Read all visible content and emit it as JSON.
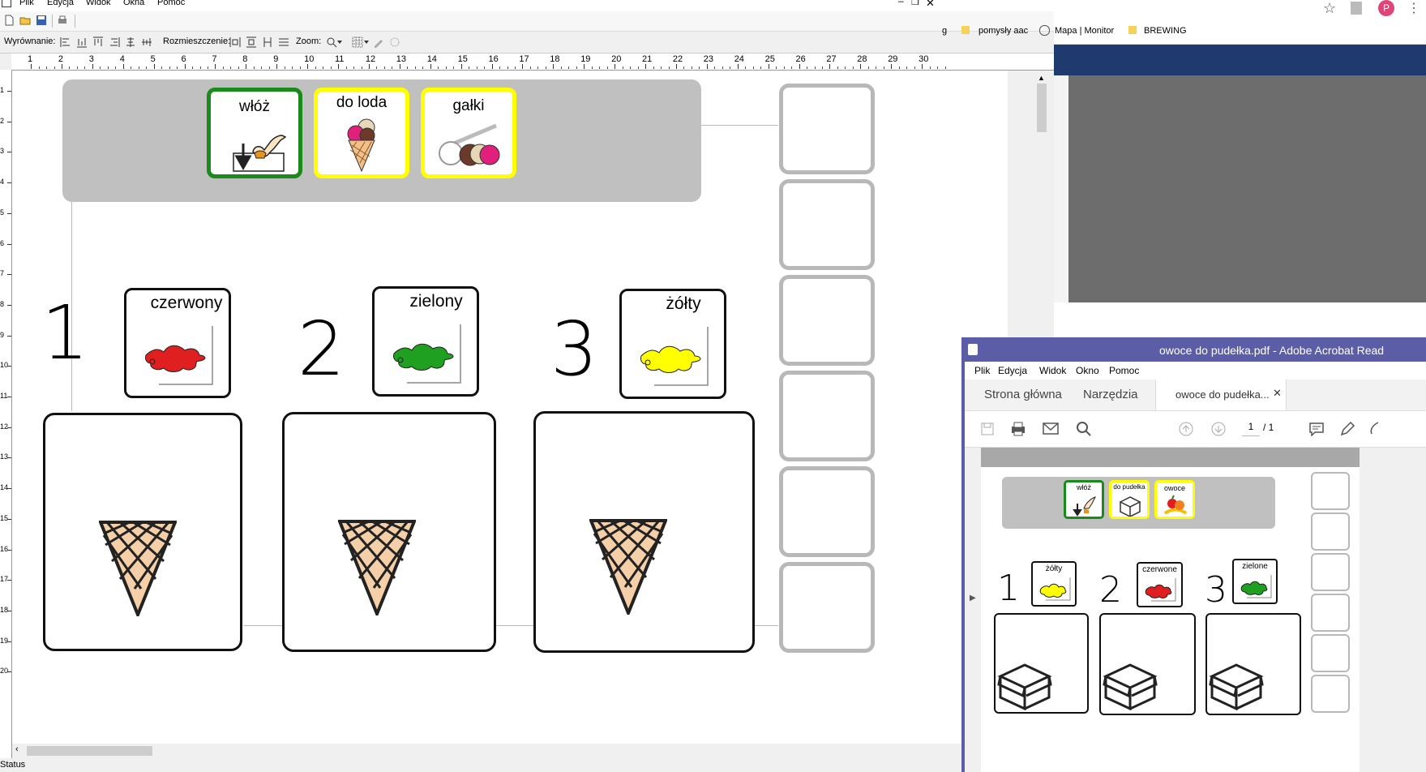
{
  "boardmaker": {
    "menu": [
      "Plik",
      "Edycja",
      "Widok",
      "Okna",
      "Pomoc"
    ],
    "align_label": "Wyrównanie:",
    "distribute_label": "Rozmieszczenie:",
    "zoom_label": "Zoom:",
    "status": "Status",
    "ruler_h": [
      "1",
      "2",
      "3",
      "4",
      "5",
      "6",
      "7",
      "8",
      "9",
      "10",
      "11",
      "12",
      "13",
      "14",
      "15",
      "16",
      "17",
      "18",
      "19",
      "20",
      "21",
      "22",
      "23",
      "24",
      "25",
      "26",
      "27",
      "28",
      "29",
      "30"
    ],
    "ruler_v": [
      "1",
      "2",
      "3",
      "4",
      "5",
      "6",
      "7",
      "8",
      "9",
      "10",
      "11",
      "12",
      "13",
      "14",
      "15",
      "16",
      "17",
      "18",
      "19",
      "20"
    ],
    "header_cards": [
      {
        "label": "włóż",
        "border": "#1a8a1a",
        "icon": "put-in-hand-icon"
      },
      {
        "label": "do loda",
        "border": "#ffff00",
        "icon": "ice-cream-cone-icon"
      },
      {
        "label": "gałki",
        "border": "#ffff00",
        "icon": "scoop-balls-icon"
      }
    ],
    "numbers": [
      "1",
      "2",
      "3"
    ],
    "color_cards": [
      {
        "label": "czerwony",
        "color": "#e02020",
        "icon": "red-splash-icon"
      },
      {
        "label": "zielony",
        "color": "#1fa020",
        "icon": "green-splash-icon"
      },
      {
        "label": "żółty",
        "color": "#ffff00",
        "icon": "yellow-splash-icon"
      }
    ]
  },
  "chrome": {
    "bookmarks": [
      "g",
      "pomysły aac",
      "Mapa | Monitor",
      "BREWING"
    ],
    "profile": "P"
  },
  "acrobat": {
    "title": "owoce do pudełka.pdf - Adobe Acrobat Read",
    "menu": [
      "Plik",
      "Edycja",
      "Widok",
      "Okno",
      "Pomoc"
    ],
    "tabs": [
      "Strona główna",
      "Narzędzia",
      "owoce do pudełka..."
    ],
    "page_current": "1",
    "page_total": "/ 1",
    "header_cards": [
      {
        "label": "włóż",
        "border": "#1a8a1a"
      },
      {
        "label": "do pudełka",
        "border": "#ffff00"
      },
      {
        "label": "owoce",
        "border": "#ffff00"
      }
    ],
    "numbers": [
      "1",
      "2",
      "3"
    ],
    "color_cards": [
      {
        "label": "żółty",
        "color": "#ffff00"
      },
      {
        "label": "czerwone",
        "color": "#e02020"
      },
      {
        "label": "zielone",
        "color": "#1fa020"
      }
    ]
  }
}
